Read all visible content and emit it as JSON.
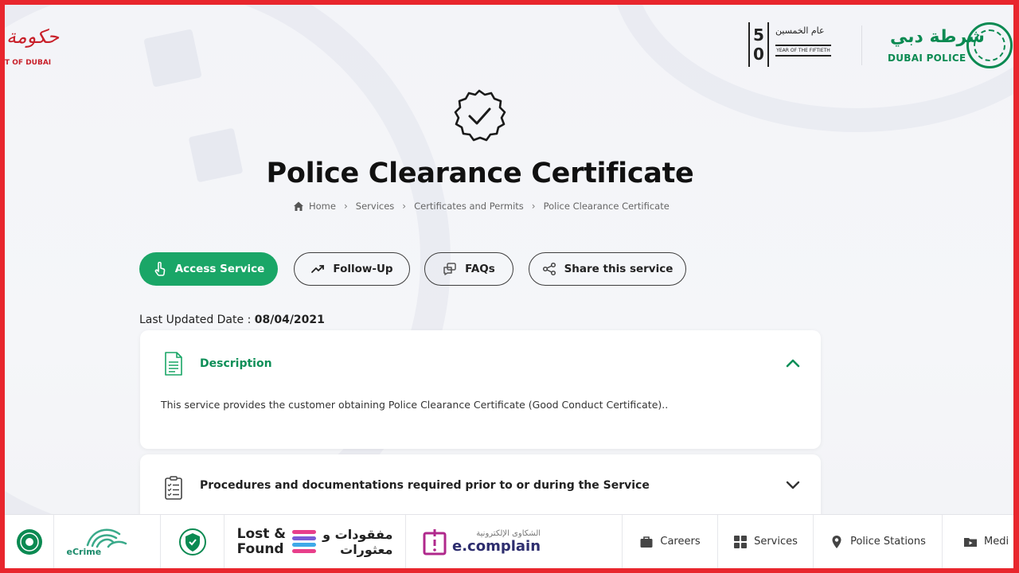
{
  "header": {
    "gov_logo_ar": "حكومة",
    "gov_logo_en": "T OF DUBAI",
    "fifty_digits": [
      "5",
      "0"
    ],
    "fifty_ar": "عام الخمسين",
    "fifty_en": "YEAR OF THE FIFTIETH",
    "dp_ar": "شرطة دبي",
    "dp_en": "DUBAI POLICE"
  },
  "page": {
    "title": "Police Clearance Certificate",
    "breadcrumb": [
      "Home",
      "Services",
      "Certificates and Permits",
      "Police Clearance Certificate"
    ],
    "last_updated_label": "Last Updated Date :",
    "last_updated_value": "08/04/2021"
  },
  "actions": {
    "access": "Access Service",
    "follow": "Follow-Up",
    "faqs": "FAQs",
    "share": "Share this service"
  },
  "accordion": {
    "description_title": "Description",
    "description_body": "This service provides the customer obtaining Police Clearance Certificate (Good Conduct Certificate)..",
    "procedures_title": "Procedures and documentations required prior to or during the Service"
  },
  "bottom_bar": {
    "ecrime": "eCrime",
    "lost_found_en_1": "Lost &",
    "lost_found_en_2": "Found",
    "lost_found_ar_1": "مفقودات و",
    "lost_found_ar_2": "معثورات",
    "ecomplain_ar": "الشكاوى الإلكترونية",
    "ecomplain_en": "e.complain",
    "careers": "Careers",
    "services": "Services",
    "police_stations": "Police Stations",
    "media": "Medi"
  },
  "colors": {
    "primary_green": "#1aa667",
    "title_green": "#0f8f58",
    "frame_red": "#e8262d"
  }
}
